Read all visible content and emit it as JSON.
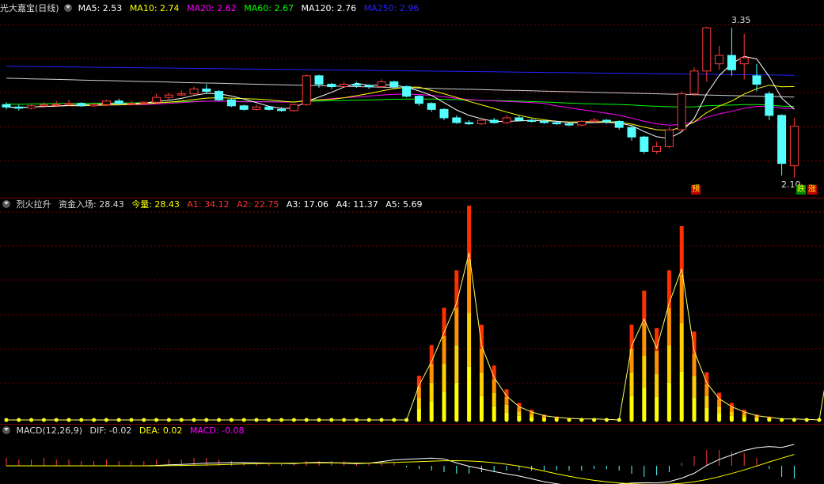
{
  "stock": {
    "name": "光大嘉宝(日线)"
  },
  "ma_legend": [
    {
      "label": "MA5: 2.53",
      "color": "#ffffff"
    },
    {
      "label": "MA10: 2.74",
      "color": "#ffff00"
    },
    {
      "label": "MA20: 2.62",
      "color": "#ff00ff"
    },
    {
      "label": "MA60: 2.67",
      "color": "#00ff00"
    },
    {
      "label": "MA120: 2.76",
      "color": "#ffffff"
    },
    {
      "label": "MA250: 2.96",
      "color": "#2222ff"
    }
  ],
  "price_annotations": {
    "high": "3.35",
    "low": "2.10",
    "tag_pre": "预",
    "tag_down": "跌",
    "tag_up": "涨"
  },
  "indicator": {
    "name": "烈火拉升",
    "fund_in": "资金入场: 28.43",
    "today_vol": "今量: 28.43",
    "levels": [
      {
        "label": "A1: 34.12",
        "color": "#ff3030"
      },
      {
        "label": "A2: 22.75",
        "color": "#ff3030"
      },
      {
        "label": "A3: 17.06",
        "color": "#ffffff"
      },
      {
        "label": "A4: 11.37",
        "color": "#ffffff"
      },
      {
        "label": "A5: 5.69",
        "color": "#ffffff"
      }
    ]
  },
  "macd": {
    "name": "MACD(12,26,9)",
    "dif": "DIF: -0.02",
    "dea": "DEA: 0.02",
    "macd": "MACD: -0.08"
  },
  "colors": {
    "up": "#ff3c3c",
    "down": "#54ffff",
    "ma5": "#ffffff",
    "ma10": "#ffff00",
    "ma20": "#ff00ff",
    "ma60": "#00ff00",
    "ma250": "#2222ff"
  },
  "chart_data": {
    "type": "candlestick",
    "candles": [
      [
        2.71,
        2.69,
        2.73,
        2.67
      ],
      [
        2.69,
        2.68,
        2.71,
        2.66
      ],
      [
        2.68,
        2.7,
        2.72,
        2.67
      ],
      [
        2.7,
        2.71,
        2.73,
        2.68
      ],
      [
        2.71,
        2.71,
        2.74,
        2.69
      ],
      [
        2.71,
        2.72,
        2.75,
        2.7
      ],
      [
        2.72,
        2.7,
        2.73,
        2.69
      ],
      [
        2.7,
        2.71,
        2.73,
        2.69
      ],
      [
        2.71,
        2.74,
        2.75,
        2.7
      ],
      [
        2.74,
        2.72,
        2.76,
        2.71
      ],
      [
        2.72,
        2.72,
        2.74,
        2.7
      ],
      [
        2.72,
        2.73,
        2.74,
        2.71
      ],
      [
        2.73,
        2.77,
        2.8,
        2.72
      ],
      [
        2.77,
        2.79,
        2.81,
        2.75
      ],
      [
        2.79,
        2.8,
        2.83,
        2.78
      ],
      [
        2.8,
        2.84,
        2.86,
        2.79
      ],
      [
        2.84,
        2.82,
        2.88,
        2.8
      ],
      [
        2.82,
        2.75,
        2.83,
        2.74
      ],
      [
        2.75,
        2.7,
        2.76,
        2.69
      ],
      [
        2.7,
        2.67,
        2.71,
        2.66
      ],
      [
        2.67,
        2.69,
        2.71,
        2.66
      ],
      [
        2.69,
        2.67,
        2.7,
        2.66
      ],
      [
        2.67,
        2.66,
        2.69,
        2.65
      ],
      [
        2.66,
        2.71,
        2.72,
        2.65
      ],
      [
        2.71,
        2.95,
        2.96,
        2.7
      ],
      [
        2.95,
        2.88,
        2.96,
        2.85
      ],
      [
        2.88,
        2.86,
        2.89,
        2.84
      ],
      [
        2.86,
        2.88,
        2.9,
        2.85
      ],
      [
        2.88,
        2.87,
        2.9,
        2.85
      ],
      [
        2.87,
        2.86,
        2.88,
        2.84
      ],
      [
        2.86,
        2.9,
        2.92,
        2.85
      ],
      [
        2.9,
        2.86,
        2.91,
        2.84
      ],
      [
        2.86,
        2.78,
        2.87,
        2.77
      ],
      [
        2.78,
        2.72,
        2.79,
        2.7
      ],
      [
        2.72,
        2.67,
        2.73,
        2.65
      ],
      [
        2.67,
        2.6,
        2.68,
        2.58
      ],
      [
        2.6,
        2.56,
        2.62,
        2.55
      ],
      [
        2.56,
        2.55,
        2.58,
        2.54
      ],
      [
        2.55,
        2.58,
        2.6,
        2.54
      ],
      [
        2.58,
        2.56,
        2.6,
        2.55
      ],
      [
        2.56,
        2.6,
        2.62,
        2.55
      ],
      [
        2.6,
        2.58,
        2.62,
        2.57
      ],
      [
        2.58,
        2.57,
        2.59,
        2.56
      ],
      [
        2.57,
        2.56,
        2.58,
        2.55
      ],
      [
        2.56,
        2.55,
        2.57,
        2.54
      ],
      [
        2.55,
        2.54,
        2.56,
        2.53
      ],
      [
        2.54,
        2.57,
        2.58,
        2.53
      ],
      [
        2.57,
        2.58,
        2.6,
        2.56
      ],
      [
        2.58,
        2.57,
        2.59,
        2.55
      ],
      [
        2.57,
        2.52,
        2.58,
        2.5
      ],
      [
        2.52,
        2.44,
        2.53,
        2.41
      ],
      [
        2.44,
        2.32,
        2.45,
        2.3
      ],
      [
        2.32,
        2.36,
        2.4,
        2.3
      ],
      [
        2.36,
        2.5,
        2.52,
        2.35
      ],
      [
        2.5,
        2.8,
        2.82,
        2.49
      ],
      [
        2.8,
        2.99,
        3.02,
        2.78
      ],
      [
        2.99,
        3.35,
        3.36,
        2.9
      ],
      [
        3.05,
        3.12,
        3.2,
        3.0
      ],
      [
        3.12,
        3.0,
        3.35,
        2.95
      ],
      [
        3.05,
        3.1,
        3.3,
        2.92
      ],
      [
        2.95,
        2.88,
        3.05,
        2.82
      ],
      [
        2.8,
        2.62,
        2.82,
        2.58
      ],
      [
        2.62,
        2.22,
        2.63,
        2.12
      ],
      [
        2.2,
        2.53,
        2.6,
        2.1
      ]
    ],
    "indicator_bars": [
      0,
      0,
      0,
      0,
      0,
      0,
      0,
      0,
      0,
      0,
      0,
      0,
      0,
      0,
      0,
      0,
      0,
      0,
      0,
      0,
      0,
      0,
      0,
      0,
      0,
      0,
      0,
      0,
      0,
      0,
      0,
      0,
      0,
      6.5,
      11,
      16.5,
      22,
      31.5,
      14,
      8,
      4.5,
      2.5,
      1.5,
      0.8,
      0.5,
      0.3,
      0.2,
      0.2,
      0.1,
      0,
      14,
      19,
      13.5,
      22,
      28.5,
      13,
      7,
      4,
      2.5,
      1.5,
      0.8,
      0.5,
      0.2,
      0.2,
      0.1,
      0,
      14,
      28.43
    ],
    "macd_hist": [
      0.05,
      0.04,
      0.04,
      0.05,
      0.04,
      0.04,
      0.03,
      0.03,
      0.04,
      0.03,
      0.03,
      0.03,
      0.04,
      0.04,
      0.04,
      0.05,
      0.05,
      0.04,
      0.03,
      0.02,
      0.02,
      0.02,
      0.01,
      0.01,
      0.03,
      0.03,
      0.03,
      0.03,
      0.02,
      0.02,
      0.02,
      0.02,
      -0.01,
      -0.02,
      -0.03,
      -0.04,
      -0.05,
      -0.05,
      -0.04,
      -0.04,
      -0.03,
      -0.03,
      -0.03,
      -0.03,
      -0.03,
      -0.03,
      -0.03,
      -0.02,
      -0.02,
      -0.03,
      -0.05,
      -0.07,
      -0.06,
      -0.04,
      0.02,
      0.06,
      0.1,
      0.1,
      0.09,
      0.08,
      0.05,
      -0.02,
      -0.07,
      -0.08
    ]
  }
}
